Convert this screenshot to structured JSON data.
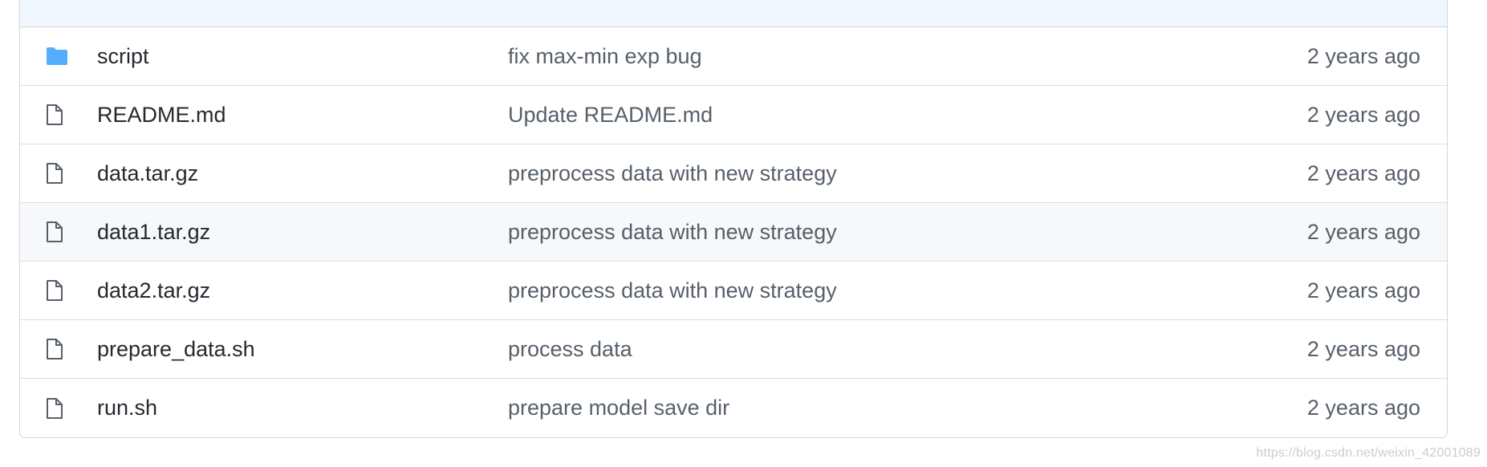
{
  "files": [
    {
      "name": "script",
      "type": "folder",
      "icon": "folder-icon",
      "message": "fix max-min exp bug",
      "age": "2 years ago"
    },
    {
      "name": "README.md",
      "type": "file",
      "icon": "file-icon",
      "message": "Update README.md",
      "age": "2 years ago"
    },
    {
      "name": "data.tar.gz",
      "type": "file",
      "icon": "file-icon",
      "message": "preprocess data with new strategy",
      "age": "2 years ago"
    },
    {
      "name": "data1.tar.gz",
      "type": "file",
      "icon": "file-icon",
      "message": "preprocess data with new strategy",
      "age": "2 years ago"
    },
    {
      "name": "data2.tar.gz",
      "type": "file",
      "icon": "file-icon",
      "message": "preprocess data with new strategy",
      "age": "2 years ago"
    },
    {
      "name": "prepare_data.sh",
      "type": "file",
      "icon": "file-icon",
      "message": "process data",
      "age": "2 years ago"
    },
    {
      "name": "run.sh",
      "type": "file",
      "icon": "file-icon",
      "message": "prepare model save dir",
      "age": "2 years ago"
    }
  ],
  "watermark": "https://blog.csdn.net/weixin_42001089",
  "colors": {
    "folder": "#54aeff",
    "file_icon": "#57606a",
    "header_bg": "#f0f7ff",
    "hover_row_bg": "#f6f8fa",
    "border": "#d0d7de"
  }
}
